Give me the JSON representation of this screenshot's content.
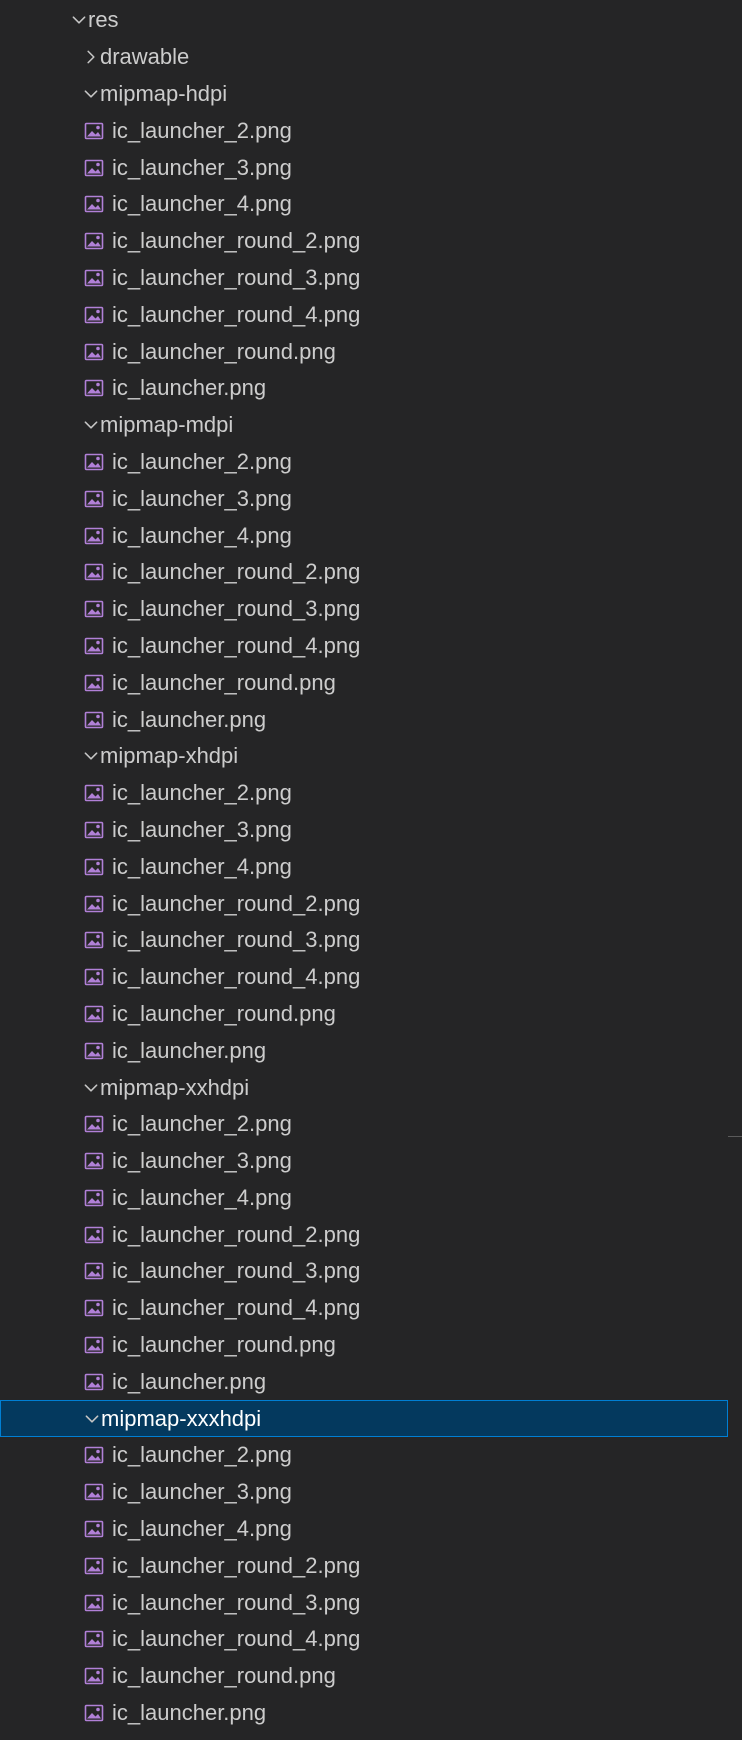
{
  "colors": {
    "background": "#252526",
    "text": "#cccccc",
    "selection_bg": "#04395e",
    "selection_border": "#007fd4",
    "image_icon": "#b180d7"
  },
  "tree": [
    {
      "type": "folder",
      "depth": 0,
      "label": "res",
      "expanded": true,
      "selected": false
    },
    {
      "type": "folder",
      "depth": 1,
      "label": "drawable",
      "expanded": false,
      "selected": false
    },
    {
      "type": "folder",
      "depth": 1,
      "label": "mipmap-hdpi",
      "expanded": true,
      "selected": false
    },
    {
      "type": "file",
      "depth": 2,
      "label": "ic_launcher_2.png",
      "icon": "image-file-icon"
    },
    {
      "type": "file",
      "depth": 2,
      "label": "ic_launcher_3.png",
      "icon": "image-file-icon"
    },
    {
      "type": "file",
      "depth": 2,
      "label": "ic_launcher_4.png",
      "icon": "image-file-icon"
    },
    {
      "type": "file",
      "depth": 2,
      "label": "ic_launcher_round_2.png",
      "icon": "image-file-icon"
    },
    {
      "type": "file",
      "depth": 2,
      "label": "ic_launcher_round_3.png",
      "icon": "image-file-icon"
    },
    {
      "type": "file",
      "depth": 2,
      "label": "ic_launcher_round_4.png",
      "icon": "image-file-icon"
    },
    {
      "type": "file",
      "depth": 2,
      "label": "ic_launcher_round.png",
      "icon": "image-file-icon"
    },
    {
      "type": "file",
      "depth": 2,
      "label": "ic_launcher.png",
      "icon": "image-file-icon"
    },
    {
      "type": "folder",
      "depth": 1,
      "label": "mipmap-mdpi",
      "expanded": true,
      "selected": false
    },
    {
      "type": "file",
      "depth": 2,
      "label": "ic_launcher_2.png",
      "icon": "image-file-icon"
    },
    {
      "type": "file",
      "depth": 2,
      "label": "ic_launcher_3.png",
      "icon": "image-file-icon"
    },
    {
      "type": "file",
      "depth": 2,
      "label": "ic_launcher_4.png",
      "icon": "image-file-icon"
    },
    {
      "type": "file",
      "depth": 2,
      "label": "ic_launcher_round_2.png",
      "icon": "image-file-icon"
    },
    {
      "type": "file",
      "depth": 2,
      "label": "ic_launcher_round_3.png",
      "icon": "image-file-icon"
    },
    {
      "type": "file",
      "depth": 2,
      "label": "ic_launcher_round_4.png",
      "icon": "image-file-icon"
    },
    {
      "type": "file",
      "depth": 2,
      "label": "ic_launcher_round.png",
      "icon": "image-file-icon"
    },
    {
      "type": "file",
      "depth": 2,
      "label": "ic_launcher.png",
      "icon": "image-file-icon"
    },
    {
      "type": "folder",
      "depth": 1,
      "label": "mipmap-xhdpi",
      "expanded": true,
      "selected": false
    },
    {
      "type": "file",
      "depth": 2,
      "label": "ic_launcher_2.png",
      "icon": "image-file-icon"
    },
    {
      "type": "file",
      "depth": 2,
      "label": "ic_launcher_3.png",
      "icon": "image-file-icon"
    },
    {
      "type": "file",
      "depth": 2,
      "label": "ic_launcher_4.png",
      "icon": "image-file-icon"
    },
    {
      "type": "file",
      "depth": 2,
      "label": "ic_launcher_round_2.png",
      "icon": "image-file-icon"
    },
    {
      "type": "file",
      "depth": 2,
      "label": "ic_launcher_round_3.png",
      "icon": "image-file-icon"
    },
    {
      "type": "file",
      "depth": 2,
      "label": "ic_launcher_round_4.png",
      "icon": "image-file-icon"
    },
    {
      "type": "file",
      "depth": 2,
      "label": "ic_launcher_round.png",
      "icon": "image-file-icon"
    },
    {
      "type": "file",
      "depth": 2,
      "label": "ic_launcher.png",
      "icon": "image-file-icon"
    },
    {
      "type": "folder",
      "depth": 1,
      "label": "mipmap-xxhdpi",
      "expanded": true,
      "selected": false
    },
    {
      "type": "file",
      "depth": 2,
      "label": "ic_launcher_2.png",
      "icon": "image-file-icon"
    },
    {
      "type": "file",
      "depth": 2,
      "label": "ic_launcher_3.png",
      "icon": "image-file-icon"
    },
    {
      "type": "file",
      "depth": 2,
      "label": "ic_launcher_4.png",
      "icon": "image-file-icon"
    },
    {
      "type": "file",
      "depth": 2,
      "label": "ic_launcher_round_2.png",
      "icon": "image-file-icon"
    },
    {
      "type": "file",
      "depth": 2,
      "label": "ic_launcher_round_3.png",
      "icon": "image-file-icon"
    },
    {
      "type": "file",
      "depth": 2,
      "label": "ic_launcher_round_4.png",
      "icon": "image-file-icon"
    },
    {
      "type": "file",
      "depth": 2,
      "label": "ic_launcher_round.png",
      "icon": "image-file-icon"
    },
    {
      "type": "file",
      "depth": 2,
      "label": "ic_launcher.png",
      "icon": "image-file-icon"
    },
    {
      "type": "folder",
      "depth": 1,
      "label": "mipmap-xxxhdpi",
      "expanded": true,
      "selected": true
    },
    {
      "type": "file",
      "depth": 2,
      "label": "ic_launcher_2.png",
      "icon": "image-file-icon"
    },
    {
      "type": "file",
      "depth": 2,
      "label": "ic_launcher_3.png",
      "icon": "image-file-icon"
    },
    {
      "type": "file",
      "depth": 2,
      "label": "ic_launcher_4.png",
      "icon": "image-file-icon"
    },
    {
      "type": "file",
      "depth": 2,
      "label": "ic_launcher_round_2.png",
      "icon": "image-file-icon"
    },
    {
      "type": "file",
      "depth": 2,
      "label": "ic_launcher_round_3.png",
      "icon": "image-file-icon"
    },
    {
      "type": "file",
      "depth": 2,
      "label": "ic_launcher_round_4.png",
      "icon": "image-file-icon"
    },
    {
      "type": "file",
      "depth": 2,
      "label": "ic_launcher_round.png",
      "icon": "image-file-icon"
    },
    {
      "type": "file",
      "depth": 2,
      "label": "ic_launcher.png",
      "icon": "image-file-icon"
    }
  ]
}
